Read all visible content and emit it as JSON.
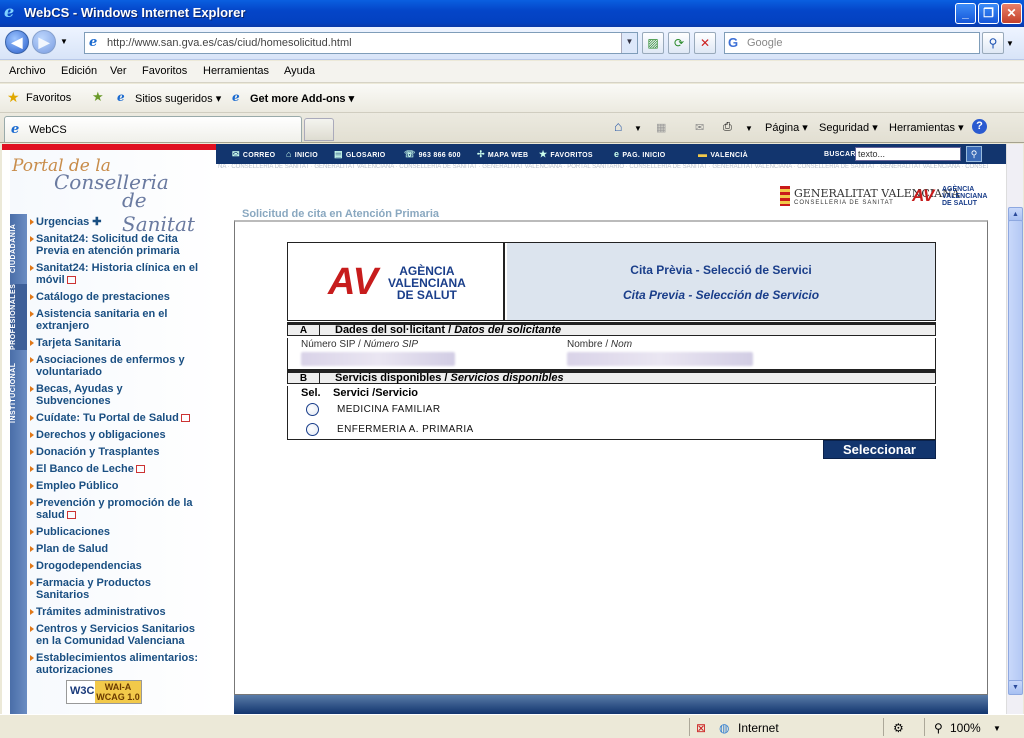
{
  "window": {
    "title": "WebCS - Windows Internet Explorer",
    "min": "_",
    "max": "❐",
    "close": "✕"
  },
  "addressbar": {
    "url": "http://www.san.gva.es/cas/ciud/homesolicitud.html",
    "search_placeholder": "Google"
  },
  "menubar": [
    "Archivo",
    "Edición",
    "Ver",
    "Favoritos",
    "Herramientas",
    "Ayuda"
  ],
  "favbar": {
    "favorites": "Favoritos",
    "suggested": "Sitios sugeridos ▾",
    "addons": "Get more Add-ons ▾"
  },
  "tab": {
    "label": "WebCS"
  },
  "commandbar": {
    "pagina": "Página ▾",
    "seguridad": "Seguridad ▾",
    "herramientas": "Herramientas ▾",
    "help": "?"
  },
  "site": {
    "topnav": [
      {
        "icon": "✉",
        "label": "CORREO"
      },
      {
        "icon": "⌂",
        "label": "INICIO"
      },
      {
        "icon": "▤",
        "label": "GLOSARIO"
      },
      {
        "icon": "☏",
        "label": "963 866 600"
      },
      {
        "icon": "✢",
        "label": "MAPA WEB"
      },
      {
        "icon": "★",
        "label": "FAVORITOS"
      },
      {
        "icon": "e",
        "label": "PAG. INICIO"
      },
      {
        "icon": "▬",
        "label": "VALENCIÀ"
      }
    ],
    "buscar_label": "BUSCAR",
    "buscar_value": "texto...",
    "watermark": "NA · CONSELLERIA DE SANITAT · GENERALITAT VALENCIANA · CONSELLERIA DE SANITAT · GENERALITAT VALENCIANA · PORTAL SANITARIO · CONSELLERIA DE SANITAT · GENERALITAT VALENCIANA · CONSELLERIA DE SANITAT · GENERALITAT VALENCIANA · CONSELLERIA DE SANITAT · GENERALITAT VALENCIANA · C",
    "portal_logo": {
      "l1": "Portal de la",
      "l2": "Conselleria",
      "l3": "de Sanitat"
    },
    "vertical_tabs": [
      "CIUDADANÍA",
      "PROFESIONALES",
      "INSTITUCIONAL"
    ],
    "gv_logo": {
      "line1": "GENERALITAT VALENCIANA",
      "line2": "CONSELLERIA DE SANITAT"
    },
    "avs_small": {
      "mark": "AV",
      "line1": "AGÈNCIA",
      "line2": "VALENCIANA",
      "line3": "DE SALUT"
    },
    "menu": [
      {
        "label": "Urgencias ✚",
        "ext": false
      },
      {
        "label": "Sanitat24: Solicitud de Cita Previa en atención primaria",
        "ext": false
      },
      {
        "label": "Sanitat24: Historia clínica en el móvil",
        "ext": true
      },
      {
        "label": "Catálogo de prestaciones",
        "ext": false
      },
      {
        "label": "Asistencia sanitaria en el extranjero",
        "ext": false
      },
      {
        "label": "Tarjeta Sanitaria",
        "ext": false
      },
      {
        "label": "Asociaciones de enfermos y voluntariado",
        "ext": false
      },
      {
        "label": "Becas, Ayudas y Subvenciones",
        "ext": false
      },
      {
        "label": "Cuídate: Tu Portal de Salud",
        "ext": true
      },
      {
        "label": "Derechos y obligaciones",
        "ext": false
      },
      {
        "label": "Donación y Trasplantes",
        "ext": false
      },
      {
        "label": "El Banco de Leche",
        "ext": true
      },
      {
        "label": "Empleo Público",
        "ext": false
      },
      {
        "label": "Prevención y promoción de la salud",
        "ext": true
      },
      {
        "label": "Publicaciones",
        "ext": false
      },
      {
        "label": "Plan de Salud",
        "ext": false
      },
      {
        "label": "Drogodependencias",
        "ext": false
      },
      {
        "label": "Farmacia y Productos Sanitarios",
        "ext": false
      },
      {
        "label": "Trámites administrativos",
        "ext": false
      },
      {
        "label": "Centros y Servicios Sanitarios en la Comunidad Valenciana",
        "ext": false
      },
      {
        "label": "Establecimientos alimentarios: autorizaciones",
        "ext": false
      }
    ],
    "w3c": {
      "w": "W3C",
      "wai": "WAI-A",
      "wcag": "WCAG 1.0"
    },
    "breadcrumb": "Solicitud de cita en Atención Primaria"
  },
  "form": {
    "logo_mark": "AV",
    "logo_name": [
      "AGÈNCIA",
      "VALENCIANA",
      "DE SALUT"
    ],
    "title_va": "Cita Prèvia - Selecció de Servici",
    "title_es": "Cita Previa - Selección de Servicio",
    "section_a": {
      "letter": "A",
      "title_va": "Dades del sol·licitant / ",
      "title_es": "Datos del solicitante"
    },
    "sip_label_va": "Número SIP / ",
    "sip_label_es": "Número SIP",
    "nom_label_va": "Nombre / ",
    "nom_label_es": "Nom",
    "section_b": {
      "letter": "B",
      "title_va": "Servicis disponibles / ",
      "title_es": "Servicios disponibles"
    },
    "col_sel": "Sel.",
    "col_servicio": "Servici /Servicio",
    "services": [
      "MEDICINA FAMILIAR",
      "ENFERMERIA A. PRIMARIA"
    ],
    "submit": "Seleccionar"
  },
  "statusbar": {
    "zone": "Internet",
    "zoom": "100%"
  }
}
